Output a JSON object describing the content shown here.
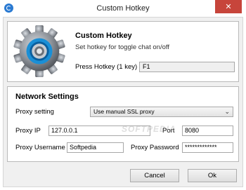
{
  "window": {
    "title": "Custom Hotkey",
    "close_glyph": "✕"
  },
  "hotkey": {
    "heading": "Custom Hotkey",
    "subtitle": "Set hotkey for toggle chat on/off",
    "press_label": "Press Hotkey (1 key)",
    "value": "F1",
    "icon": "gear-icon"
  },
  "network": {
    "heading": "Network Settings",
    "proxy_setting_label": "Proxy setting",
    "proxy_setting_value": "Use manual SSL proxy",
    "proxy_ip_label": "Proxy IP",
    "proxy_ip_value": "127.0.0.1",
    "port_label": "Port",
    "port_value": "8080",
    "username_label": "Proxy Username",
    "username_value": "Softpedia",
    "password_label": "Proxy Password",
    "password_value": "*************"
  },
  "watermark": "SOFTPEDIA",
  "buttons": {
    "cancel": "Cancel",
    "ok": "Ok"
  },
  "colors": {
    "close": "#c7453b",
    "accent": "#2a7ad2",
    "gear_ring": "#1a8fd6"
  }
}
